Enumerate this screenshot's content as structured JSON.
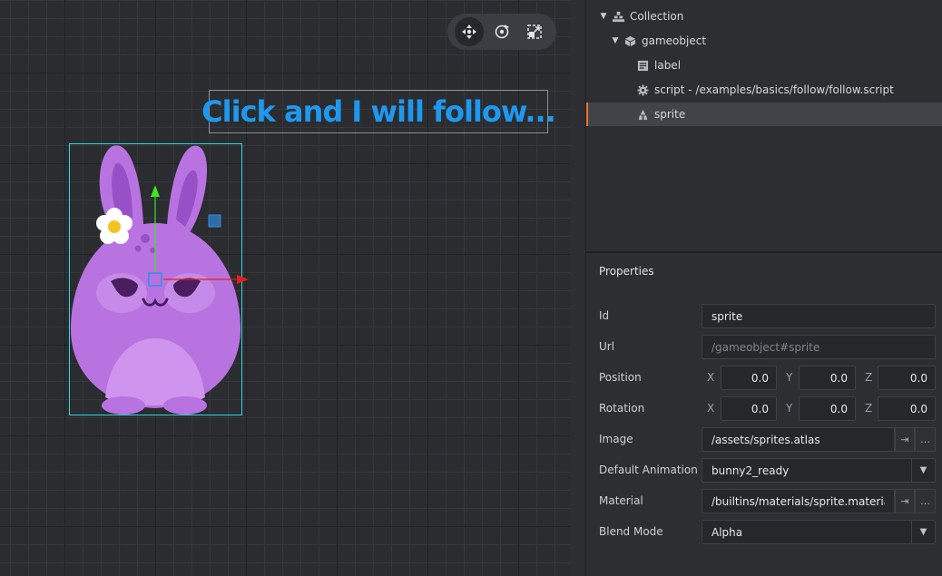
{
  "viewport": {
    "label_text": "Click and I will follow...",
    "tools": [
      {
        "name": "move-tool",
        "icon": "move-icon",
        "active": true
      },
      {
        "name": "rotate-tool",
        "icon": "rotate-icon",
        "active": false
      },
      {
        "name": "scale-tool",
        "icon": "scale-icon",
        "active": false
      }
    ]
  },
  "outline": {
    "items": [
      {
        "label": "Collection",
        "icon": "collection-icon"
      },
      {
        "label": "gameobject",
        "icon": "gameobject-icon"
      },
      {
        "label": "label",
        "icon": "label-icon"
      },
      {
        "label": "script - /examples/basics/follow/follow.script",
        "icon": "gear-icon"
      },
      {
        "label": "sprite",
        "icon": "sprite-icon"
      }
    ]
  },
  "properties": {
    "title": "Properties",
    "id_label": "Id",
    "id_value": "sprite",
    "url_label": "Url",
    "url_placeholder": "/gameobject#sprite",
    "position_label": "Position",
    "position": {
      "x": "0.0",
      "y": "0.0",
      "z": "0.0"
    },
    "rotation_label": "Rotation",
    "rotation": {
      "x": "0.0",
      "y": "0.0",
      "z": "0.0"
    },
    "axis": {
      "x": "X",
      "y": "Y",
      "z": "Z"
    },
    "image_label": "Image",
    "image_value": "/assets/sprites.atlas",
    "default_animation_label": "Default Animation",
    "default_animation_value": "bunny2_ready",
    "material_label": "Material",
    "material_value": "/builtins/materials/sprite.material",
    "blend_mode_label": "Blend Mode",
    "blend_mode_value": "Alpha",
    "goto_glyph": "⇥",
    "browse_glyph": "…",
    "dropdown_glyph": "▼"
  },
  "colors": {
    "accent": "#f0732c",
    "label_text": "#1e98ee",
    "selection_box": "#2fd7df",
    "gizmo_x": "#e3211b",
    "gizmo_y": "#3ee81e",
    "bunny": "#b873e0"
  }
}
